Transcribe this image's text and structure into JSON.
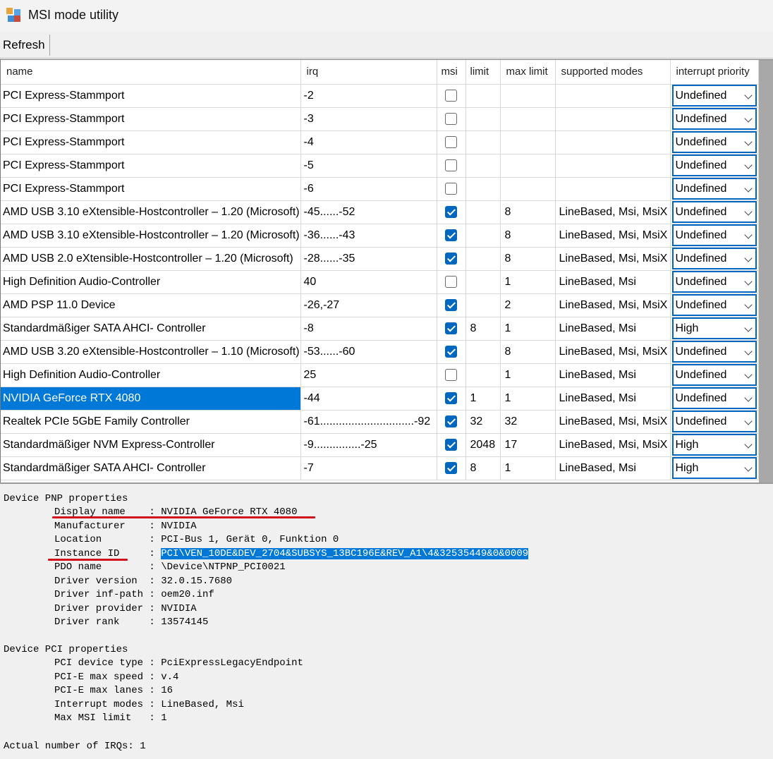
{
  "window": {
    "title": "MSI mode utility",
    "icon": "msi-app-icon"
  },
  "toolbar": {
    "refresh_label": "Refresh"
  },
  "grid": {
    "columns": [
      "name",
      "irq",
      "msi",
      "limit",
      "max limit",
      "supported modes",
      "interrupt priority"
    ],
    "rows": [
      {
        "name": "PCI Express-Stammport",
        "irq": "-2",
        "msi": false,
        "limit": "",
        "max_limit": "",
        "modes": "",
        "priority": "Undefined"
      },
      {
        "name": "PCI Express-Stammport",
        "irq": "-3",
        "msi": false,
        "limit": "",
        "max_limit": "",
        "modes": "",
        "priority": "Undefined"
      },
      {
        "name": "PCI Express-Stammport",
        "irq": "-4",
        "msi": false,
        "limit": "",
        "max_limit": "",
        "modes": "",
        "priority": "Undefined"
      },
      {
        "name": "PCI Express-Stammport",
        "irq": "-5",
        "msi": false,
        "limit": "",
        "max_limit": "",
        "modes": "",
        "priority": "Undefined"
      },
      {
        "name": "PCI Express-Stammport",
        "irq": "-6",
        "msi": false,
        "limit": "",
        "max_limit": "",
        "modes": "",
        "priority": "Undefined"
      },
      {
        "name": "AMD USB 3.10 eXtensible-Hostcontroller – 1.20 (Microsoft)",
        "irq": "-45......-52",
        "msi": true,
        "limit": "",
        "max_limit": "8",
        "modes": "LineBased, Msi, MsiX",
        "priority": "Undefined"
      },
      {
        "name": "AMD USB 3.10 eXtensible-Hostcontroller – 1.20 (Microsoft)",
        "irq": "-36......-43",
        "msi": true,
        "limit": "",
        "max_limit": "8",
        "modes": "LineBased, Msi, MsiX",
        "priority": "Undefined"
      },
      {
        "name": "AMD USB 2.0 eXtensible-Hostcontroller – 1.20 (Microsoft)",
        "irq": "-28......-35",
        "msi": true,
        "limit": "",
        "max_limit": "8",
        "modes": "LineBased, Msi, MsiX",
        "priority": "Undefined"
      },
      {
        "name": "High Definition Audio-Controller",
        "irq": "40",
        "msi": false,
        "limit": "",
        "max_limit": "1",
        "modes": "LineBased, Msi",
        "priority": "Undefined"
      },
      {
        "name": "AMD PSP 11.0 Device",
        "irq": "-26,-27",
        "msi": true,
        "limit": "",
        "max_limit": "2",
        "modes": "LineBased, Msi, MsiX",
        "priority": "Undefined"
      },
      {
        "name": "Standardmäßiger SATA AHCI- Controller",
        "irq": "-8",
        "msi": true,
        "limit": "8",
        "max_limit": "1",
        "modes": "LineBased, Msi",
        "priority": "High"
      },
      {
        "name": "AMD USB 3.20 eXtensible-Hostcontroller – 1.10 (Microsoft)",
        "irq": "-53......-60",
        "msi": true,
        "limit": "",
        "max_limit": "8",
        "modes": "LineBased, Msi, MsiX",
        "priority": "Undefined"
      },
      {
        "name": "High Definition Audio-Controller",
        "irq": "25",
        "msi": false,
        "limit": "",
        "max_limit": "1",
        "modes": "LineBased, Msi",
        "priority": "Undefined"
      },
      {
        "name": "NVIDIA GeForce RTX 4080",
        "irq": "-44",
        "msi": true,
        "limit": "1",
        "max_limit": "1",
        "modes": "LineBased, Msi",
        "priority": "Undefined",
        "selected": true
      },
      {
        "name": "Realtek PCIe 5GbE Family Controller",
        "irq": "-61..............................-92",
        "msi": true,
        "limit": "32",
        "max_limit": "32",
        "modes": "LineBased, Msi, MsiX",
        "priority": "Undefined"
      },
      {
        "name": "Standardmäßiger NVM Express-Controller",
        "irq": "-9...............-25",
        "msi": true,
        "limit": "2048",
        "max_limit": "17",
        "modes": "LineBased, Msi, MsiX",
        "priority": "High"
      },
      {
        "name": "Standardmäßiger SATA AHCI- Controller",
        "irq": "-7",
        "msi": true,
        "limit": "8",
        "max_limit": "1",
        "modes": "LineBased, Msi",
        "priority": "High"
      }
    ]
  },
  "details": {
    "pnp_header": "Device PNP properties",
    "pnp": [
      {
        "key": "Display name   ",
        "value": "NVIDIA GeForce RTX 4080"
      },
      {
        "key": "Manufacturer   ",
        "value": "NVIDIA"
      },
      {
        "key": "Location       ",
        "value": "PCI-Bus 1, Gerät 0, Funktion 0"
      },
      {
        "key": "Instance ID    ",
        "value": "PCI\\VEN_10DE&DEV_2704&SUBSYS_13BC196E&REV_A1\\4&32535449&0&0009"
      },
      {
        "key": "PDO name       ",
        "value": "\\Device\\NTPNP_PCI0021"
      },
      {
        "key": "Driver version ",
        "value": "32.0.15.7680"
      },
      {
        "key": "Driver inf-path",
        "value": "oem20.inf"
      },
      {
        "key": "Driver provider",
        "value": "NVIDIA"
      },
      {
        "key": "Driver rank    ",
        "value": "13574145"
      }
    ],
    "pci_header": "Device PCI properties",
    "pci": [
      {
        "key": "PCI device type",
        "value": "PciExpressLegacyEndpoint"
      },
      {
        "key": "PCI-E max speed",
        "value": "v.4"
      },
      {
        "key": "PCI-E max lanes",
        "value": "16"
      },
      {
        "key": "Interrupt modes",
        "value": "LineBased, Msi"
      },
      {
        "key": "Max MSI limit  ",
        "value": "1"
      }
    ],
    "irq_count_label": "Actual number of IRQs: 1"
  },
  "colors": {
    "selection": "#0078d7",
    "checkbox": "#0067c0",
    "annotation": "#d1121d"
  }
}
